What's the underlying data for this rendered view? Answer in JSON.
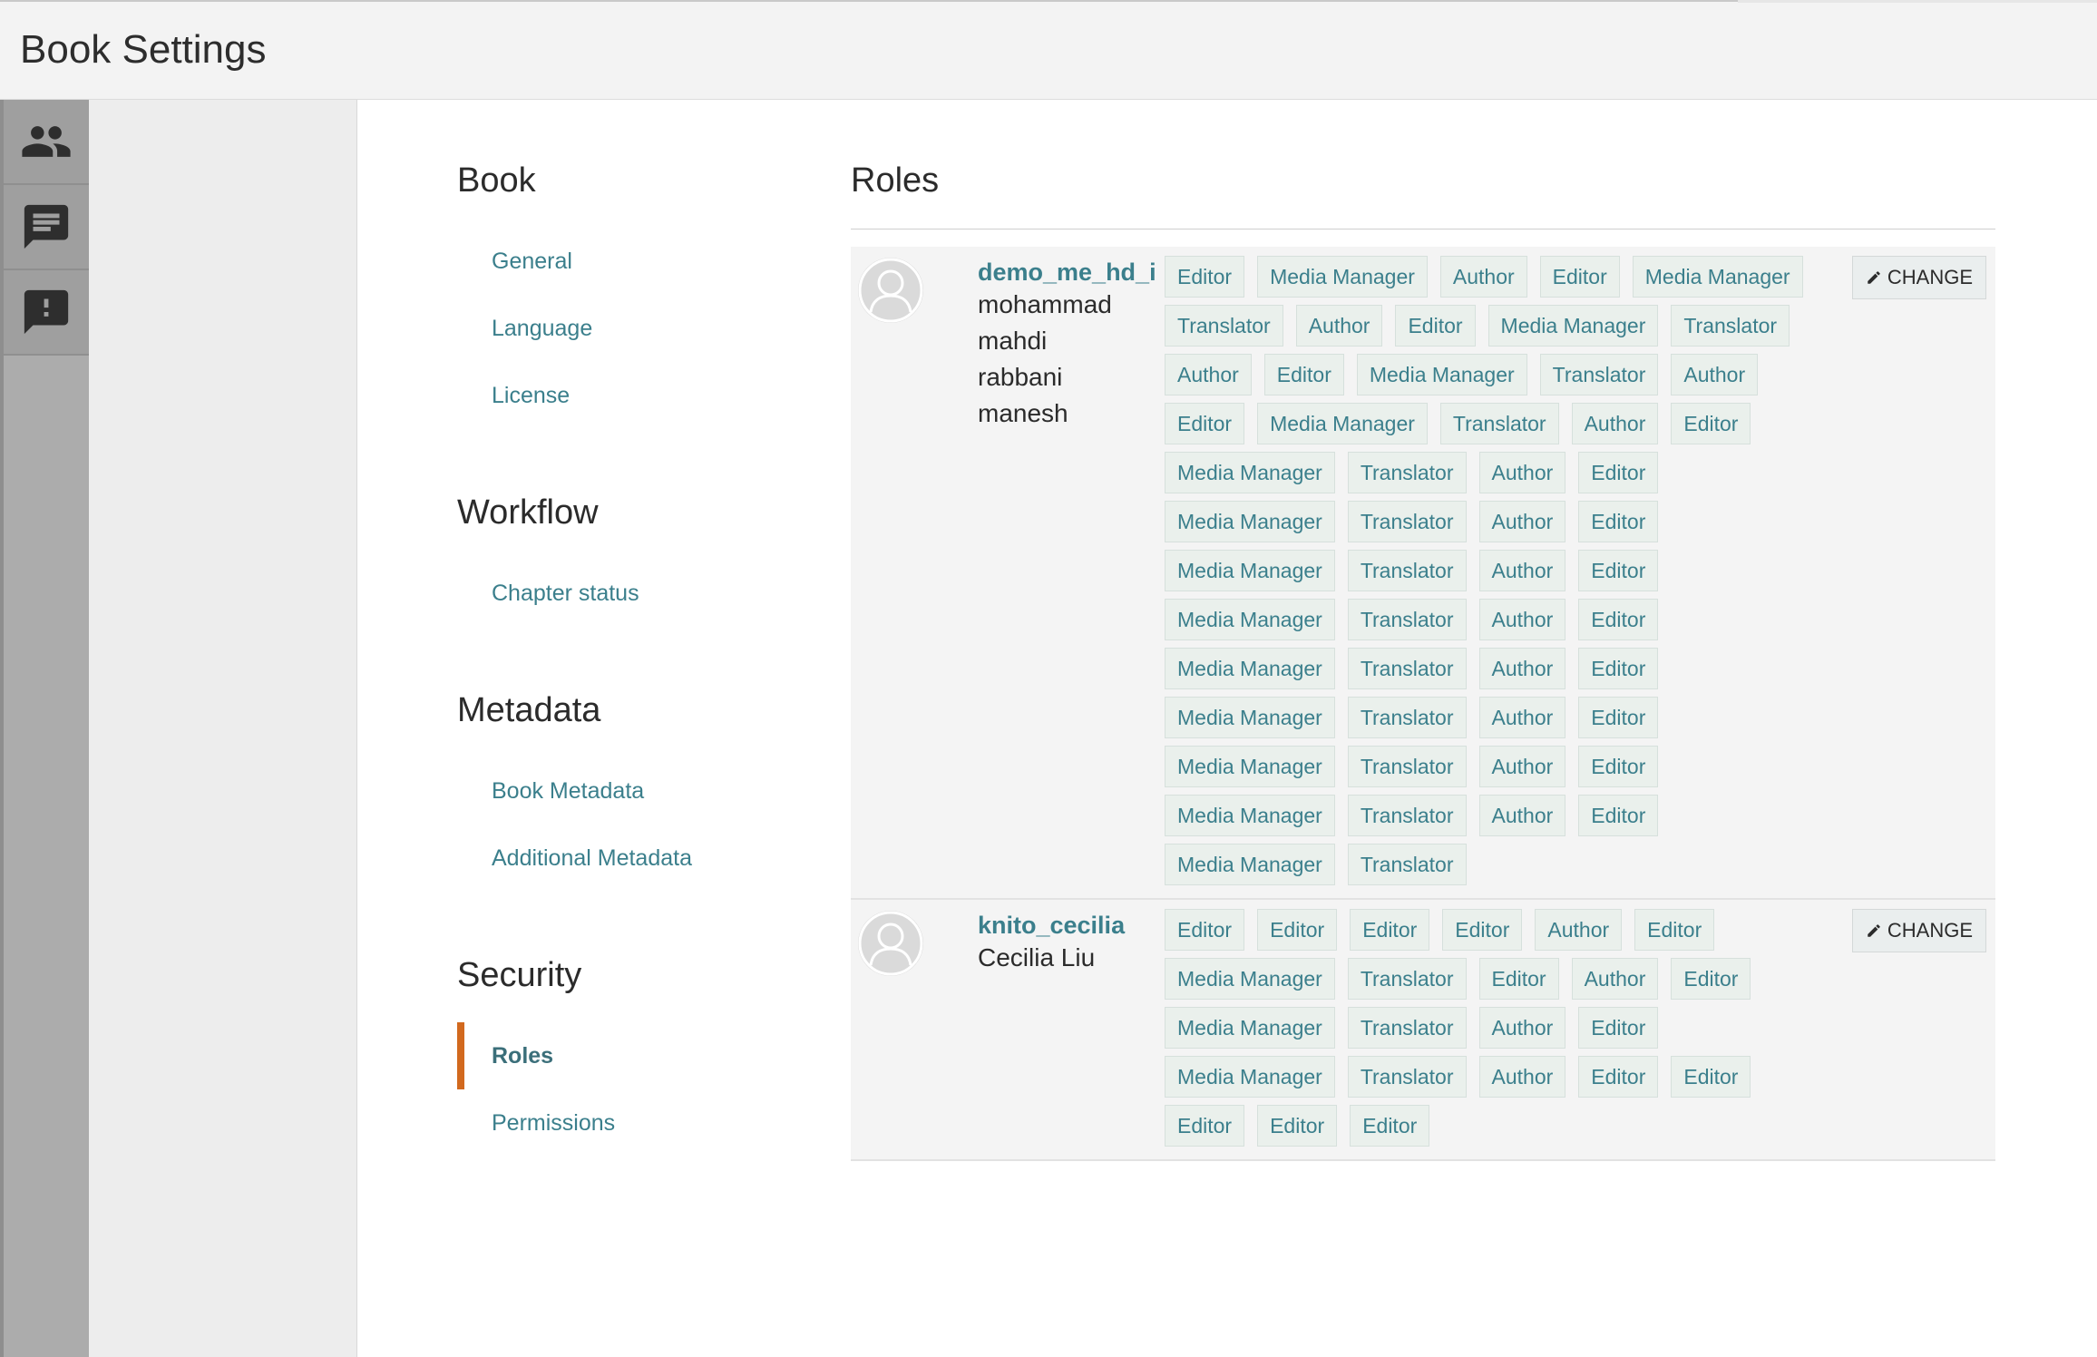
{
  "header": {
    "title": "Book Settings"
  },
  "iconbar": {
    "icons": [
      "team-icon",
      "chat-icon",
      "feedback-icon"
    ]
  },
  "nav": {
    "sections": [
      {
        "heading": "Book",
        "items": [
          "General",
          "Language",
          "License"
        ]
      },
      {
        "heading": "Workflow",
        "items": [
          "Chapter status"
        ]
      },
      {
        "heading": "Metadata",
        "items": [
          "Book Metadata",
          "Additional Metadata"
        ]
      },
      {
        "heading": "Security",
        "items": [
          "Roles",
          "Permissions"
        ],
        "active": "Roles"
      }
    ]
  },
  "roles": {
    "heading": "Roles",
    "change_label": "CHANGE",
    "users": [
      {
        "username": "demo_me_hd_i",
        "fullname": "mohammad mahdi rabbani manesh",
        "roles": [
          "Editor",
          "Media Manager",
          "Author",
          "Editor",
          "Media Manager",
          "Translator",
          "Author",
          "Editor",
          "Media Manager",
          "Translator",
          "Author",
          "Editor",
          "Media Manager",
          "Translator",
          "Author",
          "Editor",
          "Media Manager",
          "Translator",
          "Author",
          "Editor",
          "Media Manager",
          "Translator",
          "Author",
          "Editor",
          "Media Manager",
          "Translator",
          "Author",
          "Editor",
          "Media Manager",
          "Translator",
          "Author",
          "Editor",
          "Media Manager",
          "Translator",
          "Author",
          "Editor",
          "Media Manager",
          "Translator",
          "Author",
          "Editor",
          "Media Manager",
          "Translator",
          "Author",
          "Editor",
          "Media Manager",
          "Translator",
          "Author",
          "Editor",
          "Media Manager",
          "Translator",
          "Author",
          "Editor",
          "Media Manager",
          "Translator"
        ]
      },
      {
        "username": "knito_cecilia",
        "fullname": "Cecilia Liu",
        "roles": [
          "Editor",
          "Editor",
          "Editor",
          "Editor",
          "Author",
          "Editor",
          "Media Manager",
          "Translator",
          "Editor",
          "Author",
          "Editor",
          "Media Manager",
          "Translator",
          "Author",
          "Editor",
          "Media Manager",
          "Translator",
          "Author",
          "Editor",
          "Editor",
          "Editor",
          "Editor",
          "Editor"
        ]
      }
    ]
  }
}
